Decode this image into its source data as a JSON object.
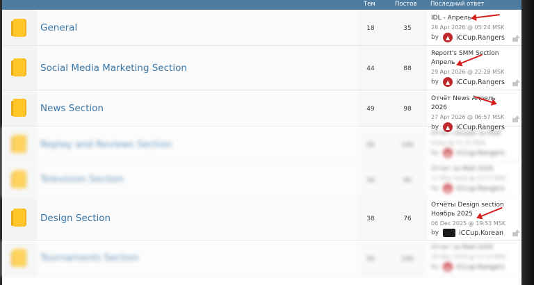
{
  "header": {
    "topics_label": "Тем",
    "posts_label": "Постов",
    "last_post_label": "Последний ответ"
  },
  "forums": [
    {
      "name": "General",
      "topics": "18",
      "posts": "35",
      "last_title": "IDL - Апрель",
      "last_date": "28 Apr 2026 @ 05:24 MSK",
      "by_label": "by",
      "user": "iCCup.Rangers",
      "blurred": false
    },
    {
      "name": "Social Media Marketing Section",
      "topics": "44",
      "posts": "88",
      "last_title": "Report's SMM Section Апрель",
      "last_date": "29 Apr 2026 @ 22:28 MSK",
      "by_label": "by",
      "user": "iCCup.Rangers",
      "blurred": false
    },
    {
      "name": "News Section",
      "topics": "49",
      "posts": "98",
      "last_title": "Отчёт News Апрель 2026",
      "last_date": "27 Apr 2026 @ 06:57 MSK",
      "by_label": "by",
      "user": "iCCup.Rangers",
      "blurred": false
    },
    {
      "name": "Replay and Reviews Section",
      "topics": "50",
      "posts": "100",
      "last_title": "Отчет секции за Май",
      "last_date": "today @ 11:33 MSK",
      "by_label": "by",
      "user": "iCCup.Rangers",
      "blurred": true
    },
    {
      "name": "Television Section",
      "topics": "30",
      "posts": "90",
      "last_title": "Отчет за Май 2026",
      "last_date": "27 May 2026 @ 13:27 MSK",
      "by_label": "by",
      "user": "iCCup.Rangers",
      "blurred": true
    },
    {
      "name": "Design Section",
      "topics": "38",
      "posts": "76",
      "last_title": "Отчёты Design section Ноябрь 2025",
      "last_date": "06 Dec 2025 @ 19:53 MSK",
      "by_label": "by",
      "user": "iCCup.Korean",
      "blurred": false
    },
    {
      "name": "Tournaments Section",
      "topics": "50",
      "posts": "100",
      "last_title": "Отчет за Май 2026",
      "last_date": "28 May 2026 @ 12:10 MSK",
      "by_label": "by",
      "user": "iCCup.Rangers",
      "blurred": true
    }
  ],
  "colors": {
    "header_bg": "#4e7ca1",
    "link": "#3a76a6",
    "folder": "#ffc629",
    "annotation": "#d41f1f"
  },
  "icons": {
    "forum": "folder-icon",
    "avatar": "avatar-icon",
    "goto": "goto-last-post-icon"
  }
}
